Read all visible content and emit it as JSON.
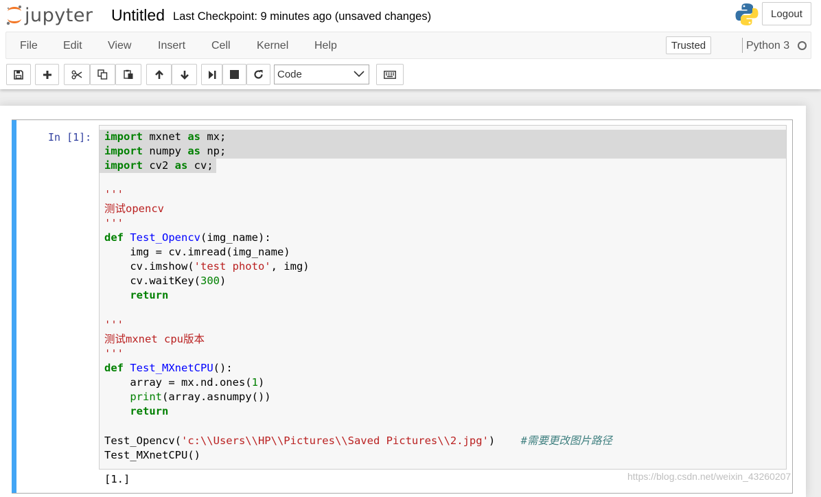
{
  "header": {
    "logo_text": "jupyter",
    "notebook_title": "Untitled",
    "checkpoint": "Last Checkpoint: 9 minutes ago (unsaved changes)",
    "logout_label": "Logout"
  },
  "menubar": {
    "items": [
      "File",
      "Edit",
      "View",
      "Insert",
      "Cell",
      "Kernel",
      "Help"
    ],
    "trusted_label": "Trusted",
    "kernel_name": "Python 3"
  },
  "toolbar": {
    "buttons": [
      "save-icon",
      "plus-icon",
      "cut-icon",
      "copy-icon",
      "paste-icon",
      "arrow-up-icon",
      "arrow-down-icon",
      "run-step-icon",
      "stop-icon",
      "restart-icon",
      "keyboard-icon"
    ],
    "cell_type": "Code"
  },
  "cell": {
    "prompt": "In [1]:",
    "lines": [
      "import mxnet as mx;",
      "import numpy as np;",
      "import cv2 as cv;",
      "",
      "'''",
      "测试opencv",
      "'''",
      "def Test_Opencv(img_name):",
      "    img = cv.imread(img_name)",
      "    cv.imshow('test photo', img)",
      "    cv.waitKey(300)",
      "    return",
      "",
      "'''",
      "测试mxnet cpu版本",
      "'''",
      "def Test_MXnetCPU():",
      "    array = mx.nd.ones(1)",
      "    print(array.asnumpy())",
      "    return",
      "",
      "Test_Opencv('c:\\\\Users\\\\HP\\\\Pictures\\\\Saved Pictures\\\\2.jpg')    #需要更改图片路径",
      "Test_MXnetCPU()"
    ],
    "output": "[1.]"
  },
  "watermark": "https://blog.csdn.net/weixin_43260207",
  "colors": {
    "cell_bar": "#42a5f5",
    "keyword": "#008000",
    "string": "#ba2121",
    "function_name": "#0000ff",
    "comment": "#408080",
    "prompt": "#303f9f"
  }
}
